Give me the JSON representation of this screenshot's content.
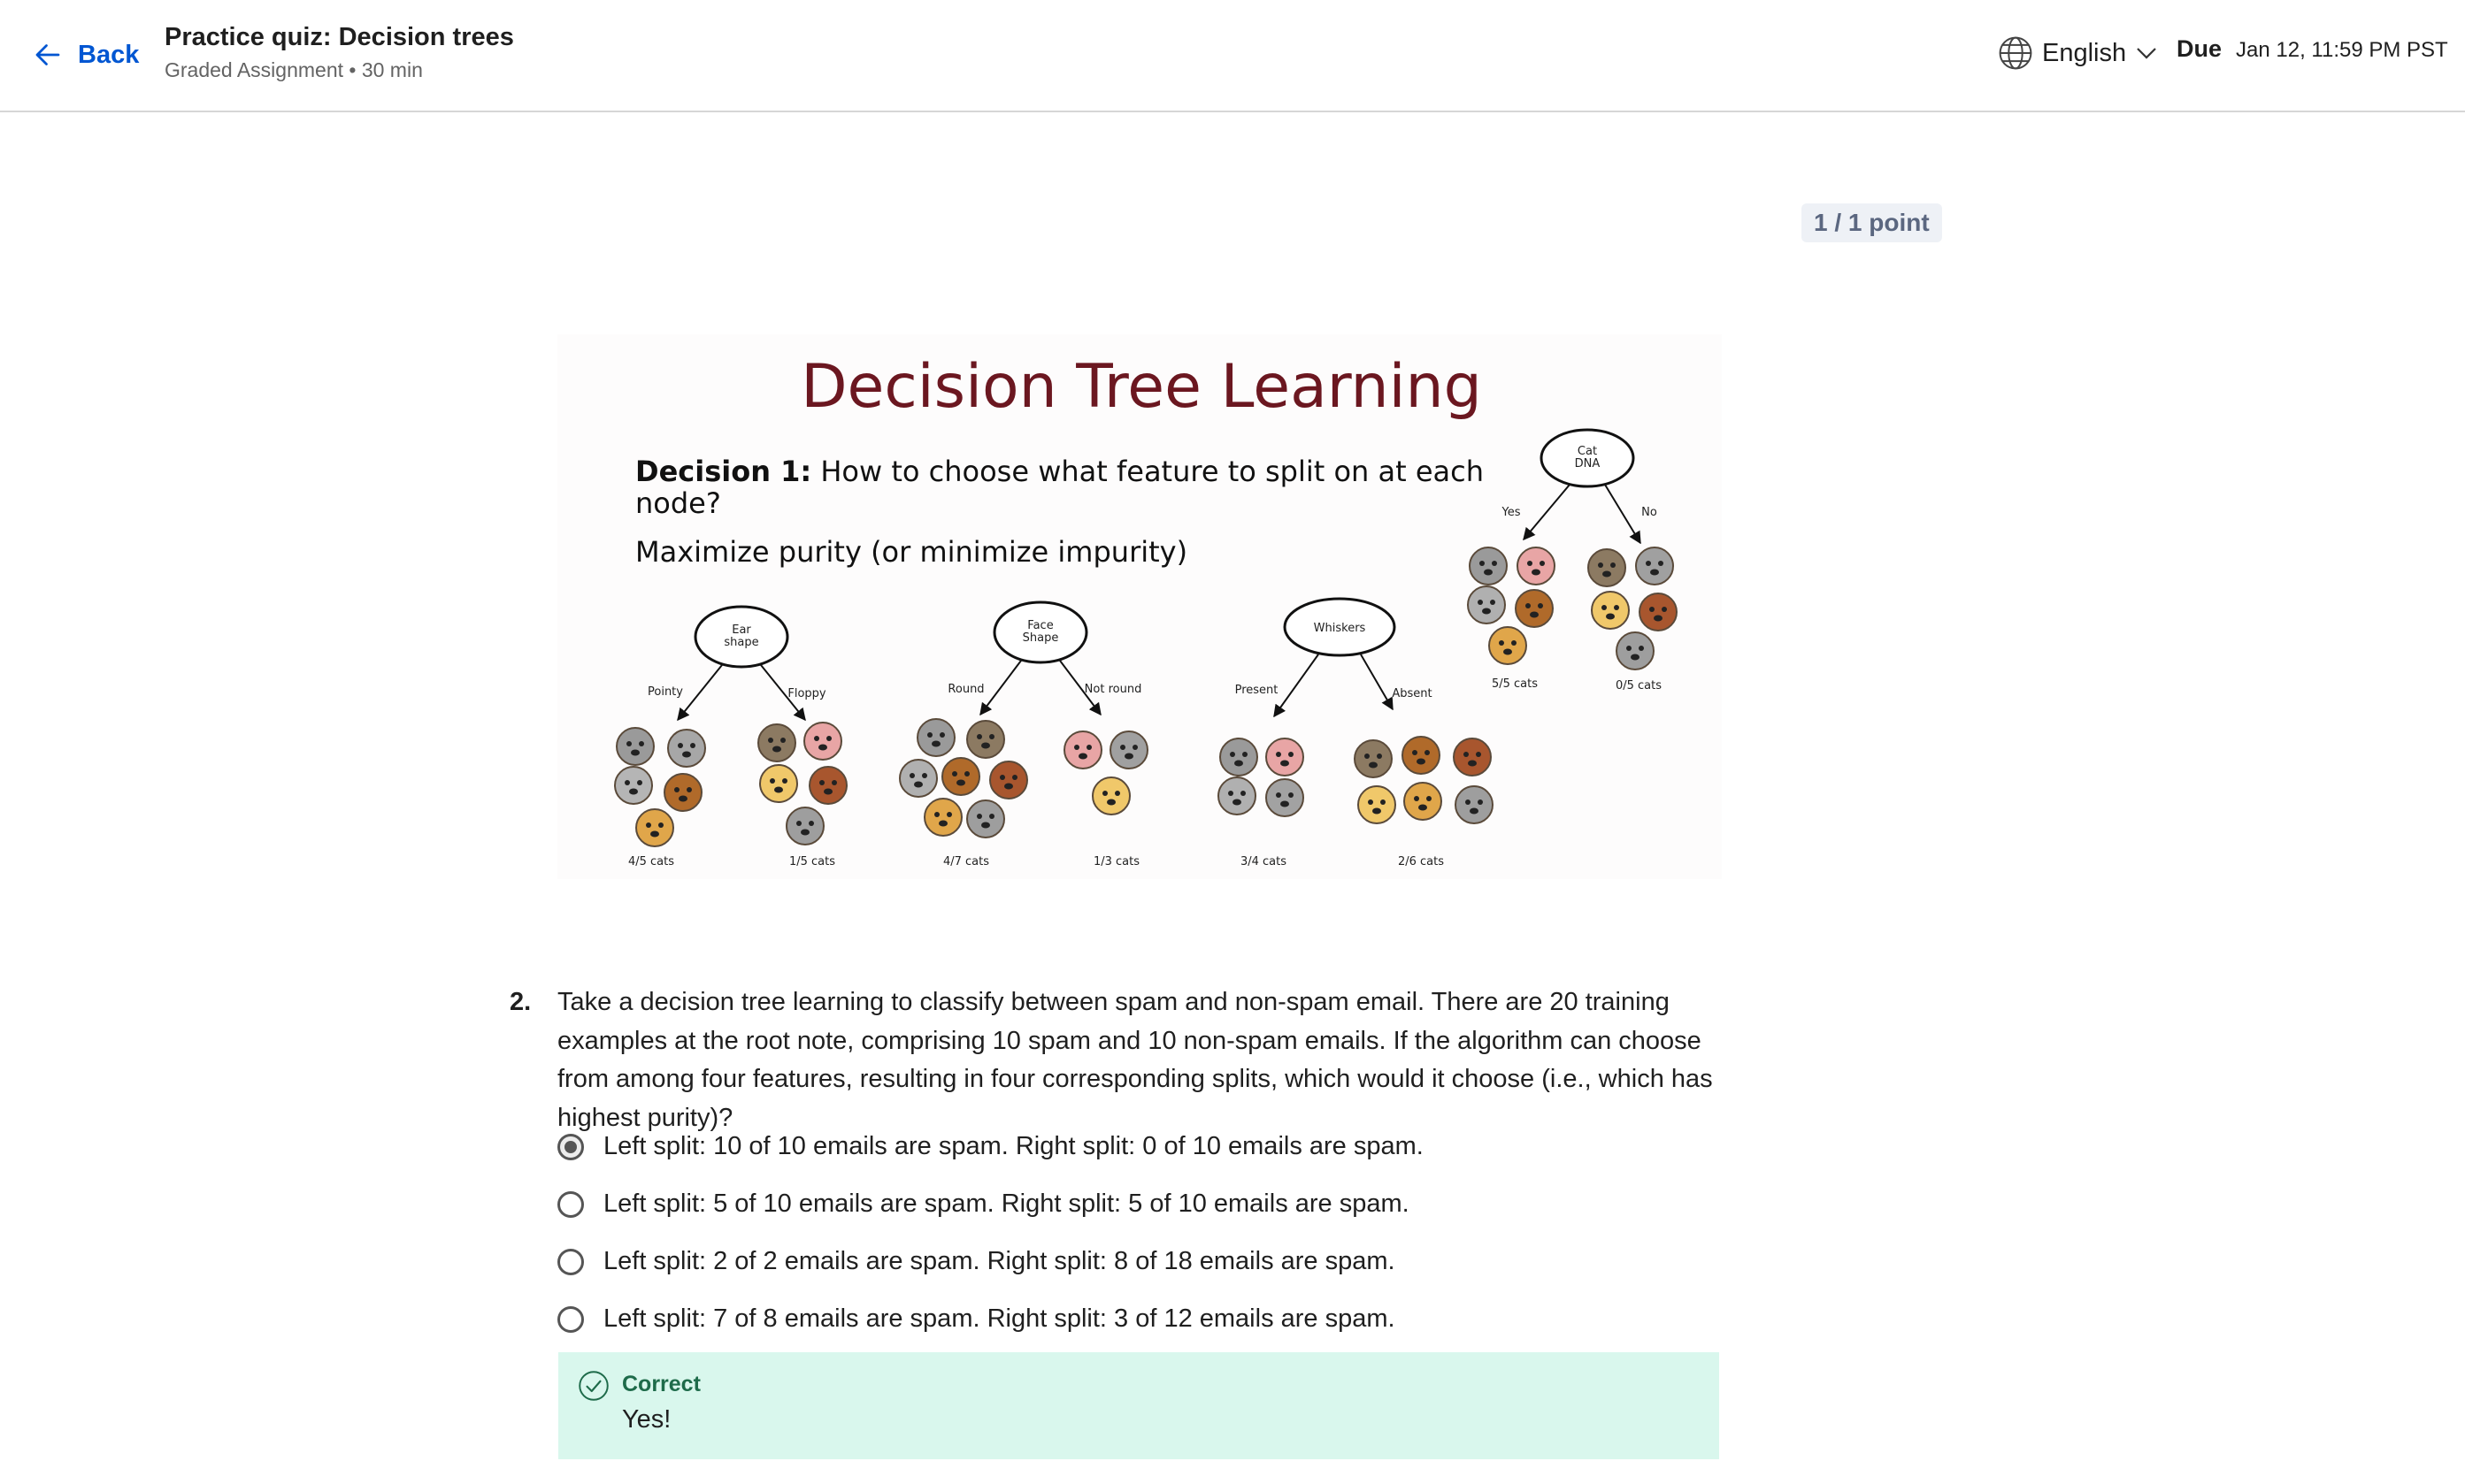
{
  "header": {
    "back_label": "Back",
    "quiz_title": "Practice quiz: Decision trees",
    "quiz_subtitle": "Graded Assignment • 30 min",
    "language": "English",
    "due_label": "Due",
    "due_date": "Jan 12, 11:59 PM PST"
  },
  "score": {
    "points": "1 / 1 point"
  },
  "figure": {
    "title": "Decision Tree Learning",
    "decision_bold": "Decision 1:",
    "decision_text": " How to choose what feature to split on at each",
    "decision_text2": "node?",
    "objective": "Maximize purity (or minimize impurity)",
    "trees": [
      {
        "node_line1": "Ear",
        "node_line2": "shape",
        "left": "Pointy",
        "right": "Floppy",
        "left_result": "4/5 cats",
        "right_result": "1/5 cats"
      },
      {
        "node_line1": "Face",
        "node_line2": "Shape",
        "left": "Round",
        "right": "Not round",
        "left_result": "4/7 cats",
        "right_result": "1/3 cats"
      },
      {
        "node_line1": "Whiskers",
        "node_line2": "",
        "left": "Present",
        "right": "Absent",
        "left_result": "3/4 cats",
        "right_result": "2/6 cats"
      },
      {
        "node_line1": "Cat",
        "node_line2": "DNA",
        "left": "Yes",
        "right": "No",
        "left_result": "5/5 cats",
        "right_result": "0/5 cats"
      }
    ],
    "colors": {
      "title": "#6b1720",
      "gray_cat": "#9a9a9a",
      "orange_cat": "#d99a3e",
      "brown_dog": "#a8562e",
      "tan_dog": "#8c7a62",
      "yellow_dog": "#f0c86a",
      "pink_cat": "#e8a5a5"
    }
  },
  "question": {
    "number": "2.",
    "text": "Take a decision tree learning to classify between spam and non-spam email. There are 20 training examples at the root note, comprising 10 spam and 10 non-spam emails. If the algorithm can choose from among four features, resulting in four corresponding splits, which would it choose (i.e., which has highest purity)?",
    "options": [
      {
        "label": "Left split: 10 of 10 emails are spam. Right split: 0 of 10 emails are spam.",
        "selected": true
      },
      {
        "label": "Left split: 5 of 10 emails are spam. Right split: 5 of 10 emails are spam.",
        "selected": false
      },
      {
        "label": "Left split: 2 of 2 emails are spam. Right split: 8 of 18 emails are spam.",
        "selected": false
      },
      {
        "label": "Left split: 7 of 8 emails are spam. Right split: 3 of 12 emails are spam.",
        "selected": false
      }
    ]
  },
  "feedback": {
    "status": "Correct",
    "message": "Yes!",
    "bg_color": "#d9f7ed",
    "status_color": "#1e6b4a"
  }
}
